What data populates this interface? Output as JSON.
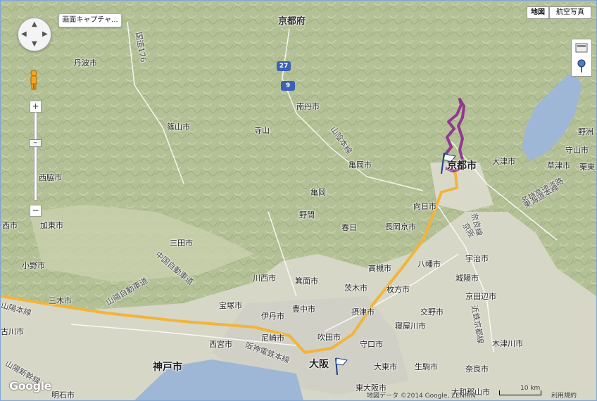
{
  "map": {
    "capture_button": "画面キャプチャ...",
    "map_type_buttons": [
      "地図",
      "航空写真"
    ],
    "zoom_in": "+",
    "zoom_out": "−",
    "zoom_tick": "−",
    "brand": "Google",
    "attribution": "地図データ ©2014 Google, ZENRIN",
    "scale": "10 km",
    "terms": "利用規約",
    "colors": {
      "route": "#f2b43a",
      "track": "#8d2a8d",
      "terrain": "#b9c59a",
      "water": "#9fb7d6"
    }
  },
  "labels": [
    {
      "id": "kyoto-pref",
      "text": "京都府",
      "cls": "pref"
    },
    {
      "id": "tamba",
      "text": "丹波市"
    },
    {
      "id": "nantan",
      "text": "南丹市"
    },
    {
      "id": "sasayama",
      "text": "篠山市"
    },
    {
      "id": "nishiwaki",
      "text": "西脇市"
    },
    {
      "id": "kameoka",
      "text": "亀岡市"
    },
    {
      "id": "kyoto-city",
      "text": "京都市",
      "cls": "big"
    },
    {
      "id": "otsu",
      "text": "大津市"
    },
    {
      "id": "yasu",
      "text": "野洲"
    },
    {
      "id": "moriyama",
      "text": "守山市"
    },
    {
      "id": "kusatsu",
      "text": "草津市"
    },
    {
      "id": "ritto",
      "text": "栗東"
    },
    {
      "id": "muko",
      "text": "向日市"
    },
    {
      "id": "nagaokakyo",
      "text": "長岡京市"
    },
    {
      "id": "kasai",
      "text": "加東市"
    },
    {
      "id": "sanda",
      "text": "三田市"
    },
    {
      "id": "ono",
      "text": "小野市"
    },
    {
      "id": "miki",
      "text": "三木市"
    },
    {
      "id": "kawanishi",
      "text": "川西市"
    },
    {
      "id": "mino",
      "text": "箕面市"
    },
    {
      "id": "takatsuki",
      "text": "高槻市"
    },
    {
      "id": "yawata",
      "text": "八幡市"
    },
    {
      "id": "uji",
      "text": "宇治市"
    },
    {
      "id": "joyo",
      "text": "城陽市"
    },
    {
      "id": "ibaraki",
      "text": "茨木市"
    },
    {
      "id": "hirakata",
      "text": "枚方市"
    },
    {
      "id": "kyotanabe",
      "text": "京田辺市"
    },
    {
      "id": "takarazuka",
      "text": "宝塚市"
    },
    {
      "id": "itami",
      "text": "伊丹市"
    },
    {
      "id": "toyonaka",
      "text": "豊中市"
    },
    {
      "id": "settsu",
      "text": "摂津市"
    },
    {
      "id": "katano",
      "text": "交野市"
    },
    {
      "id": "neyagawa",
      "text": "寝屋川市"
    },
    {
      "id": "kakogawa",
      "text": "古川市"
    },
    {
      "id": "nishinomiya",
      "text": "西宮市"
    },
    {
      "id": "amagasaki",
      "text": "尼崎市"
    },
    {
      "id": "suita",
      "text": "吹田市"
    },
    {
      "id": "moriguchi",
      "text": "守口市"
    },
    {
      "id": "kizugawa",
      "text": "木津川市"
    },
    {
      "id": "kobe",
      "text": "神戸市",
      "cls": "big"
    },
    {
      "id": "osaka",
      "text": "大阪",
      "cls": "big"
    },
    {
      "id": "daito",
      "text": "大東市"
    },
    {
      "id": "ikoma",
      "text": "生駒市"
    },
    {
      "id": "nara",
      "text": "奈良市"
    },
    {
      "id": "higashiosaka",
      "text": "東大阪市"
    },
    {
      "id": "yamatokoriyama",
      "text": "大和郡山市"
    },
    {
      "id": "akashi",
      "text": "明石市"
    },
    {
      "id": "xshi",
      "text": "西市"
    },
    {
      "id": "kayao",
      "text": "亀岡"
    },
    {
      "id": "sano",
      "text": "野間"
    },
    {
      "id": "kasugai",
      "text": "春日"
    },
    {
      "id": "jsumotosan",
      "text": "寺山"
    },
    {
      "id": "route-sanyo",
      "text": "山陽自動車道",
      "cls": "rot"
    },
    {
      "id": "route-chugoku",
      "text": "中国自動車道",
      "cls": "rot"
    },
    {
      "id": "route-sanin",
      "text": "山陰本線",
      "cls": "rot"
    },
    {
      "id": "route-hanshin",
      "text": "阪神電鉄本線",
      "cls": "rot"
    },
    {
      "id": "route-sanyoshinkansen",
      "text": "山陽新幹線",
      "cls": "rot"
    },
    {
      "id": "route-keihan",
      "text": "京阪",
      "cls": "rot"
    },
    {
      "id": "route-meishin",
      "text": "名神高速道路",
      "cls": "rot"
    },
    {
      "id": "route-kintetsu",
      "text": "近鉄京都線",
      "cls": "rot"
    },
    {
      "id": "route-nara",
      "text": "奈良線",
      "cls": "rot"
    },
    {
      "id": "route-tokaido",
      "text": "東海道本線",
      "cls": "rot"
    },
    {
      "id": "route-sanyomain",
      "text": "山陽本線",
      "cls": "rot"
    },
    {
      "id": "route-r176",
      "text": "国道176",
      "cls": "rot"
    }
  ],
  "shields": [
    {
      "id": "r27",
      "text": "27",
      "color": "#3b62b5"
    },
    {
      "id": "r9",
      "text": "9",
      "color": "#3b62b5"
    }
  ]
}
